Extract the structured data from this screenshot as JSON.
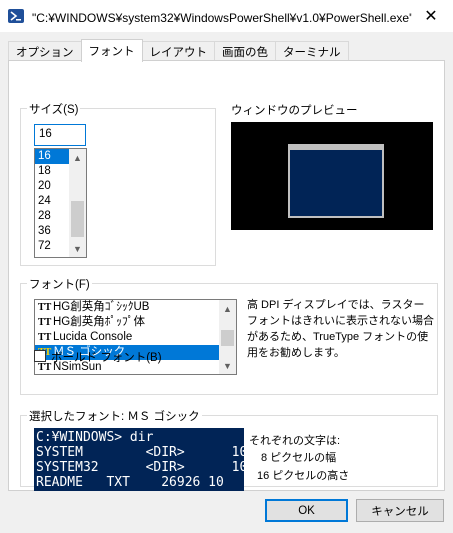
{
  "window": {
    "title": "\"C:¥WINDOWS¥system32¥WindowsPowerShell¥v1.0¥PowerShell.exe\"の...",
    "icon": "powershell-icon",
    "close_glyph": "✕"
  },
  "tabs": [
    {
      "label": "オプション",
      "active": false
    },
    {
      "label": "フォント",
      "active": true
    },
    {
      "label": "レイアウト",
      "active": false
    },
    {
      "label": "画面の色",
      "active": false
    },
    {
      "label": "ターミナル",
      "active": false
    }
  ],
  "size": {
    "label": "サイズ(S)",
    "value": "16",
    "options": [
      "16",
      "18",
      "20",
      "24",
      "28",
      "36",
      "72"
    ],
    "selected": "16"
  },
  "preview": {
    "label": "ウィンドウのプレビュー",
    "bg_color": "#000000",
    "window_color": "#012456"
  },
  "font": {
    "label": "フォント(F)",
    "options": [
      "HG創英角ｺﾞｼｯｸUB",
      "HG創英角ﾎﾟｯﾌﾟ体",
      "Lucida Console",
      "ＭＳ ゴシック",
      "NSimSun"
    ],
    "selected": "ＭＳ ゴシック",
    "description_lines": [
      "高 DPI ディスプレイでは、ラスター",
      "フォントはきれいに表示されない場合",
      "があるため、TrueType フォントの使",
      "用をお勧めします。"
    ],
    "bold_label": "ボールド フォント(B)",
    "bold_checked": false
  },
  "selected_font": {
    "label": "選択したフォント: ＭＳ ゴシック",
    "console_lines": [
      "C:¥WINDOWS> dir",
      "SYSTEM        <DIR>      10",
      "SYSTEM32      <DIR>      10",
      "README   TXT    26926 10"
    ],
    "console_bg": "#012456",
    "info_title": "それぞれの文字は:",
    "width_text": "8 ピクセルの幅",
    "height_text": "16 ピクセルの高さ"
  },
  "buttons": {
    "ok": "OK",
    "cancel": "キャンセル"
  },
  "colors": {
    "accent": "#0078d7",
    "console_blue": "#012456"
  }
}
